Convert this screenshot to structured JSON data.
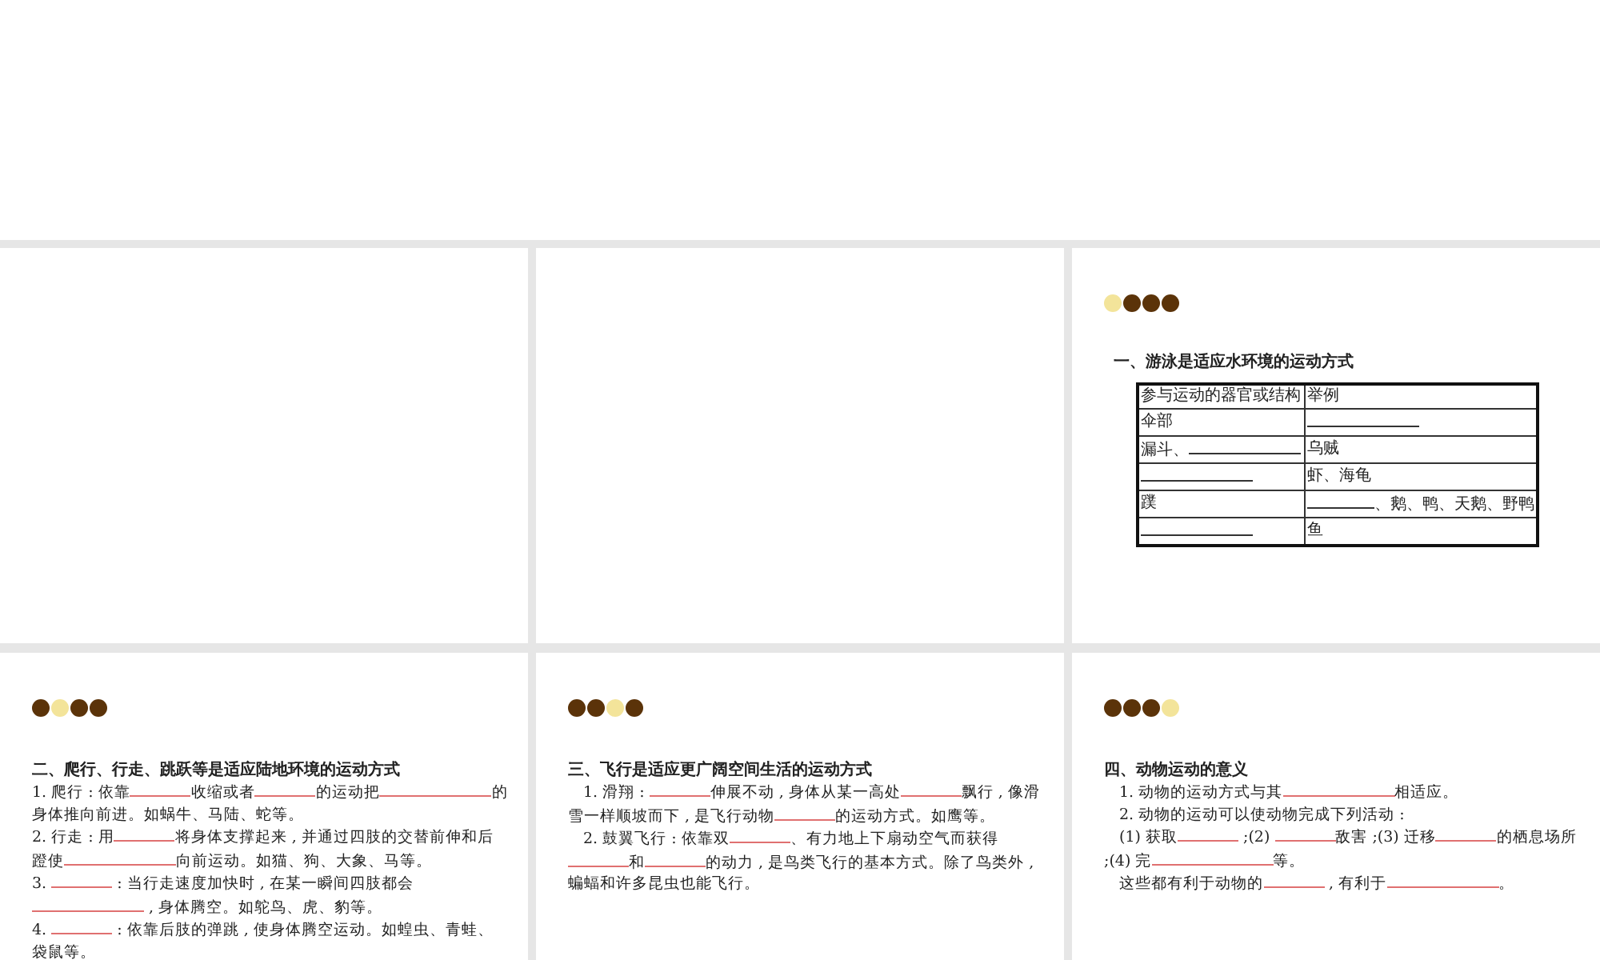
{
  "slides": [
    {
      "kind": "empty"
    },
    {
      "kind": "empty"
    },
    {
      "kind": "content",
      "dots": [
        {
          "selected": true
        },
        {
          "selected": false
        },
        {
          "selected": false
        },
        {
          "selected": false
        }
      ],
      "heading": "一、游泳是适应水环境的运动方式",
      "table": {
        "columns": [
          "参与运动的器官或结构",
          "举例"
        ],
        "rows": [
          [
            [
              {
                "kind": "text",
                "text": "伞部"
              }
            ],
            [
              {
                "kind": "long_blank"
              }
            ]
          ],
          [
            [
              {
                "kind": "text",
                "text": "漏斗、"
              },
              {
                "kind": "long_blank"
              }
            ],
            [
              {
                "kind": "text",
                "text": "乌贼"
              }
            ]
          ],
          [
            [
              {
                "kind": "long_blank"
              }
            ],
            [
              {
                "kind": "text",
                "text": "虾、海龟"
              }
            ]
          ],
          [
            [
              {
                "kind": "text",
                "text": "蹼"
              }
            ],
            [
              {
                "kind": "blank"
              },
              {
                "kind": "text",
                "text": "、鹅、鸭、天鹅、野鸭"
              }
            ]
          ],
          [
            [
              {
                "kind": "long_blank"
              }
            ],
            [
              {
                "kind": "text",
                "text": "鱼"
              }
            ]
          ]
        ]
      }
    },
    {
      "kind": "content",
      "dots": [
        {
          "selected": false
        },
        {
          "selected": true
        },
        {
          "selected": false
        },
        {
          "selected": false
        }
      ],
      "heading": "二、爬行、行走、跳跃等是适应陆地环境的运动方式",
      "paragraphs": [
        {
          "indent": false,
          "segments": [
            {
              "kind": "text",
              "text": "1. 爬行 : 依靠"
            },
            {
              "kind": "blank"
            },
            {
              "kind": "text",
              "text": "收缩或者"
            },
            {
              "kind": "blank"
            },
            {
              "kind": "text",
              "text": "的运动把"
            },
            {
              "kind": "long_blank"
            },
            {
              "kind": "text",
              "text": "的身体推向前进。如蜗牛、马陆、蛇等。"
            }
          ]
        },
        {
          "indent": false,
          "segments": [
            {
              "kind": "text",
              "text": "2. 行走 : 用"
            },
            {
              "kind": "blank"
            },
            {
              "kind": "text",
              "text": "将身体支撑起来 , 并通过四肢的交替前伸和后蹬使"
            },
            {
              "kind": "long_blank"
            },
            {
              "kind": "text",
              "text": "向前运动。如猫、狗、大象、马等。"
            }
          ]
        },
        {
          "indent": false,
          "segments": [
            {
              "kind": "text",
              "text": "3. "
            },
            {
              "kind": "blank"
            },
            {
              "kind": "text",
              "text": " : 当行走速度加快时 , 在某一瞬间四肢都会"
            },
            {
              "kind": "long_blank"
            },
            {
              "kind": "text",
              "text": " , 身体腾空。如鸵鸟、虎、豹等。"
            }
          ]
        },
        {
          "indent": false,
          "segments": [
            {
              "kind": "text",
              "text": "4. "
            },
            {
              "kind": "blank"
            },
            {
              "kind": "text",
              "text": " : 依靠后肢的弹跳 , 使身体腾空运动。如蝗虫、青蛙、袋鼠等。"
            }
          ]
        }
      ]
    },
    {
      "kind": "content",
      "dots": [
        {
          "selected": false
        },
        {
          "selected": false
        },
        {
          "selected": true
        },
        {
          "selected": false
        }
      ],
      "heading": "三、飞行是适应更广阔空间生活的运动方式",
      "paragraphs": [
        {
          "indent": true,
          "segments": [
            {
              "kind": "text",
              "text": "1. 滑翔 : "
            },
            {
              "kind": "blank"
            },
            {
              "kind": "text",
              "text": "伸展不动 , 身体从某一高处"
            },
            {
              "kind": "blank"
            },
            {
              "kind": "text",
              "text": "飘行 , 像滑雪一样顺坡而下 , 是飞行动物"
            },
            {
              "kind": "blank"
            },
            {
              "kind": "text",
              "text": "的运动方式。如鹰等。"
            }
          ]
        },
        {
          "indent": true,
          "segments": [
            {
              "kind": "text",
              "text": "2. 鼓翼飞行 : 依靠双"
            },
            {
              "kind": "blank"
            },
            {
              "kind": "text",
              "text": "、有力地上下扇动空气而获得"
            },
            {
              "kind": "blank"
            },
            {
              "kind": "text",
              "text": "和"
            },
            {
              "kind": "blank"
            },
            {
              "kind": "text",
              "text": "的动力 , 是鸟类飞行的基本方式。除了鸟类外 , 蝙蝠和许多昆虫也能飞行。"
            }
          ]
        }
      ]
    },
    {
      "kind": "content",
      "dots": [
        {
          "selected": false
        },
        {
          "selected": false
        },
        {
          "selected": false
        },
        {
          "selected": true
        }
      ],
      "heading": "四、动物运动的意义",
      "paragraphs": [
        {
          "indent": true,
          "segments": [
            {
              "kind": "text",
              "text": "1. 动物的运动方式与其"
            },
            {
              "kind": "long_blank"
            },
            {
              "kind": "text",
              "text": "相适应。"
            }
          ]
        },
        {
          "indent": true,
          "segments": [
            {
              "kind": "text",
              "text": "2. 动物的运动可以使动物完成下列活动 :"
            }
          ]
        },
        {
          "indent": true,
          "segments": [
            {
              "kind": "text",
              "text": "(1) 获取"
            },
            {
              "kind": "blank"
            },
            {
              "kind": "text",
              "text": " ;(2) "
            },
            {
              "kind": "blank"
            },
            {
              "kind": "text",
              "text": "敌害 ;(3) 迁移"
            },
            {
              "kind": "blank"
            },
            {
              "kind": "text",
              "text": "的栖息场所 ;(4) 完"
            },
            {
              "kind": "blank"
            },
            {
              "kind": "blank"
            },
            {
              "kind": "text",
              "text": "等。"
            }
          ]
        },
        {
          "indent": true,
          "segments": [
            {
              "kind": "text",
              "text": "这些都有利于动物的"
            },
            {
              "kind": "blank"
            },
            {
              "kind": "text",
              "text": " , 有利于"
            },
            {
              "kind": "long_blank"
            },
            {
              "kind": "text",
              "text": "。"
            }
          ]
        }
      ]
    }
  ]
}
